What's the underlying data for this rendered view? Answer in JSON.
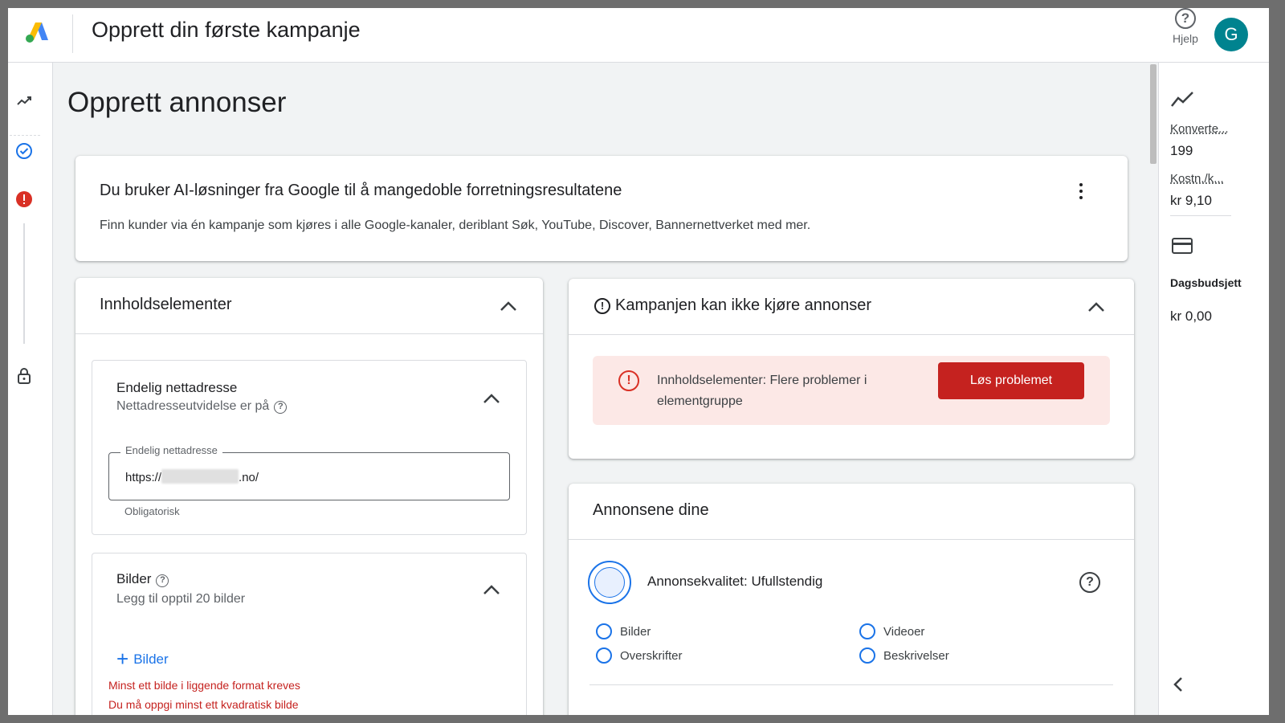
{
  "header": {
    "title": "Opprett din første kampanje",
    "help_label": "Hjelp",
    "avatar_initial": "G"
  },
  "page": {
    "title": "Opprett annonser"
  },
  "banner": {
    "title": "Du bruker AI-løsninger fra Google til å mangedoble forretningsresultatene",
    "description": "Finn kunder via én kampanje som kjøres i alle Google-kanaler, deriblant Søk, YouTube, Discover, Bannernettverket med mer."
  },
  "content_card": {
    "title": "Innholdselementer",
    "final_url": {
      "title": "Endelig nettadresse",
      "subtitle": "Nettadresseutvidelse er på",
      "field_label": "Endelig nettadresse",
      "value_prefix": "https://",
      "value_suffix": ".no/",
      "helper": "Obligatorisk"
    },
    "images": {
      "title": "Bilder",
      "subtitle": "Legg til opptil 20 bilder",
      "add_label": "Bilder",
      "errors": [
        "Minst ett bilde i liggende format kreves",
        "Du må oppgi minst ett kvadratisk bilde"
      ]
    }
  },
  "warning_card": {
    "title": "Kampanjen kan ikke kjøre annonser",
    "alert_text": "Innholdselementer: Flere problemer i elementgruppe",
    "fix_button": "Løs problemet"
  },
  "ads_card": {
    "title": "Annonsene dine",
    "quality": "Annonsekvalitet: Ufullstendig",
    "checklist": [
      "Bilder",
      "Videoer",
      "Overskrifter",
      "Beskrivelser"
    ]
  },
  "right_panel": {
    "conversions_label": "Konverte...",
    "conversions_value": "199",
    "cost_label": "Kostn./k...",
    "cost_value": "kr 9,10",
    "budget_label": "Dagsbudsjett",
    "budget_value": "kr 0,00"
  },
  "colors": {
    "accent": "#1a73e8",
    "error": "#c5221f",
    "alert_bg": "#fce8e6",
    "avatar": "#00838f"
  }
}
